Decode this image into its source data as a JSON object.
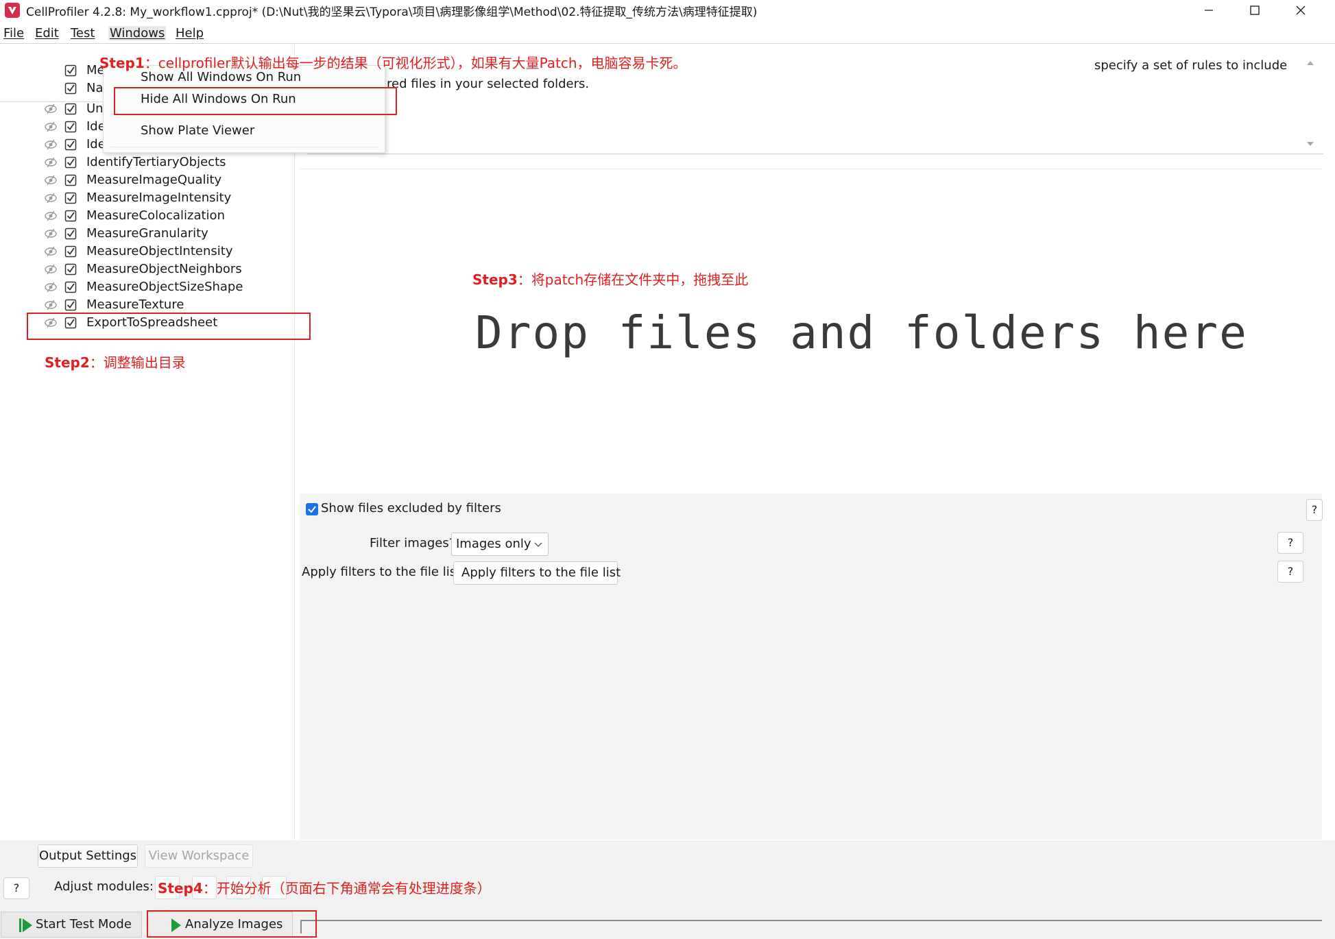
{
  "window": {
    "title": "CellProfiler 4.2.8: My_workflow1.cpproj* (D:\\Nut\\我的坚果云\\Typora\\项目\\病理影像组学\\Method\\02.特征提取_传统方法\\病理特征提取)",
    "icon": "cellprofiler-logo-icon",
    "accent_color": "#d32f4a"
  },
  "menubar": {
    "items": [
      "File",
      "Edit",
      "Test",
      "Windows",
      "Help"
    ]
  },
  "windows_menu": {
    "items": [
      "Show All Windows On Run",
      "Hide All Windows On Run",
      "Show Plate Viewer"
    ]
  },
  "pipeline": {
    "modules": [
      {
        "label": "Me",
        "has_eye": false
      },
      {
        "label": "Na",
        "has_eye": false
      },
      {
        "label": "Un",
        "has_eye": true
      },
      {
        "label": "Ide",
        "has_eye": true
      },
      {
        "label": "Ide",
        "has_eye": true
      },
      {
        "label": "IdentifyTertiaryObjects",
        "has_eye": true
      },
      {
        "label": "MeasureImageQuality",
        "has_eye": true
      },
      {
        "label": "MeasureImageIntensity",
        "has_eye": true
      },
      {
        "label": "MeasureColocalization",
        "has_eye": true
      },
      {
        "label": "MeasureGranularity",
        "has_eye": true
      },
      {
        "label": "MeasureObjectIntensity",
        "has_eye": true
      },
      {
        "label": "MeasureObjectNeighbors",
        "has_eye": true
      },
      {
        "label": "MeasureObjectSizeShape",
        "has_eye": true
      },
      {
        "label": "MeasureTexture",
        "has_eye": true
      },
      {
        "label": "ExportToSpreadsheet",
        "has_eye": true
      }
    ]
  },
  "help_text": {
    "line1": "specify a set of rules to include",
    "line2": "red files in your selected folders."
  },
  "drop_zone": {
    "text": "Drop files and folders here"
  },
  "settings": {
    "show_excluded_label": "Show files excluded by filters",
    "show_excluded_checked": true,
    "filter_images_label": "Filter images?",
    "filter_images_value": "Images only",
    "apply_filters_label": "Apply filters to the file list",
    "apply_filters_button": "Apply filters to the file list",
    "help_button": "?"
  },
  "bottom": {
    "output_settings": "Output Settings",
    "view_workspace": "View Workspace",
    "help_button": "?",
    "adjust_modules_label": "Adjust modules:",
    "start_test_mode": "Start Test Mode",
    "analyze_images": "Analyze Images"
  },
  "annotations": {
    "color": "#e02020",
    "step1_tag": "Step1",
    "step1_text": "：cellprofiler默认输出每一步的结果（可视化形式），如果有大量Patch，电脑容易卡死。",
    "step2_tag": "Step2",
    "step2_text": "：调整输出目录",
    "step3_tag": "Step3",
    "step3_text": "：将patch存储在文件夹中，拖拽至此",
    "step4_tag": "Step4",
    "step4_text": "：开始分析（页面右下角通常会有处理进度条）"
  }
}
